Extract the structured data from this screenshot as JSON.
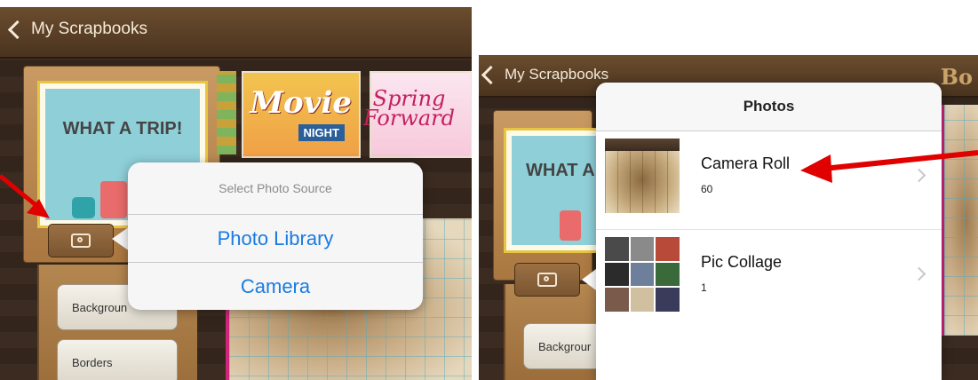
{
  "left_screen": {
    "back_label": "My Scrapbooks",
    "trip_card_title": "WHAT A TRIP!",
    "thumb_movie_line1": "Movie",
    "thumb_movie_line2": "NIGHT",
    "thumb_spring_line1": "Spring",
    "thumb_spring_line2": "Forward",
    "popover": {
      "title": "Select Photo Source",
      "options": [
        "Photo Library",
        "Camera"
      ]
    },
    "sidebar": [
      "Backgroun",
      "Borders"
    ]
  },
  "right_screen": {
    "back_label": "My Scrapbooks",
    "title_partial": "Bo",
    "trip_card_title": "WHAT A",
    "popover": {
      "title": "Photos",
      "albums": [
        {
          "name": "Camera Roll",
          "count": "60"
        },
        {
          "name": "Pic Collage",
          "count": "1"
        }
      ]
    },
    "sidebar": [
      "Backgrour"
    ]
  },
  "colors": {
    "ios_blue": "#1a7be0",
    "annotation_red": "#e00000",
    "accent_pink": "#d0257a"
  },
  "icons": [
    "back-chevron-icon",
    "camera-icon",
    "disclosure-chevron-icon",
    "red-arrow-annotation"
  ]
}
